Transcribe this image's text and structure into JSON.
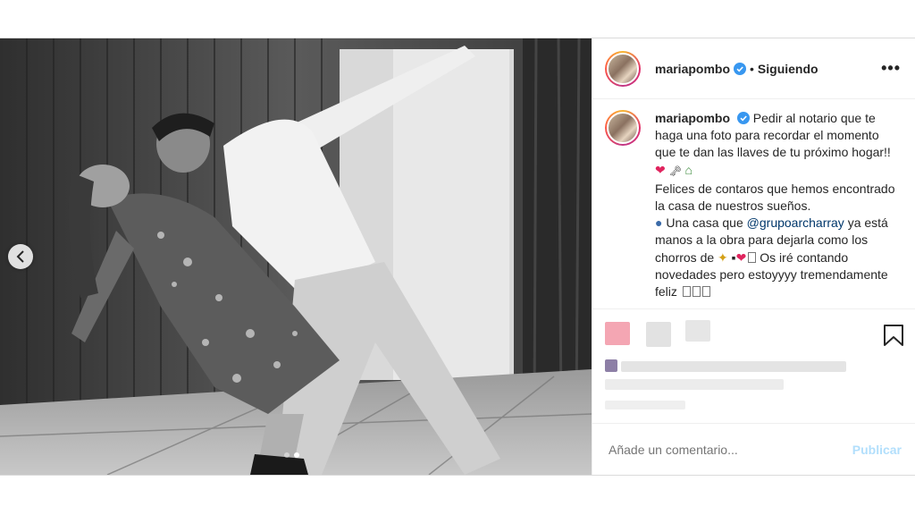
{
  "post": {
    "username": "mariapombo",
    "separator": "•",
    "follow_status": "Siguiendo",
    "more_label": "•••",
    "caption": {
      "username": "mariapombo",
      "line1": "Pedir al notario que te haga una foto para recordar el momento que te dan las llaves de tu próximo hogar!!",
      "line2": "Felices de contaros que hemos encontrado la casa de nuestros sueños.",
      "line3_pre": "Una casa que",
      "mention": "@grupoarcharray",
      "line3_post": "ya está manos a la obra para dejarla como los chorros de",
      "line4": "Os iré contando novedades pero estoyyyy tremendamente feliz"
    },
    "photo": {
      "active_slide": 2,
      "slide_count": 2
    }
  },
  "comment": {
    "placeholder": "Añade un comentario...",
    "publish_label": "Publicar"
  },
  "icons": {
    "verified": "verified-badge-icon",
    "prev": "chevron-left-icon",
    "bookmark": "bookmark-icon",
    "heart": "red-heart-emoji",
    "key": "key-emoji",
    "house": "house-emoji",
    "sparkles": "sparkles-emoji"
  },
  "colors": {
    "verified_blue": "#3897f0",
    "mention": "#00376b",
    "publish_disabled": "#b2dffc",
    "heart": "#e0245e"
  }
}
